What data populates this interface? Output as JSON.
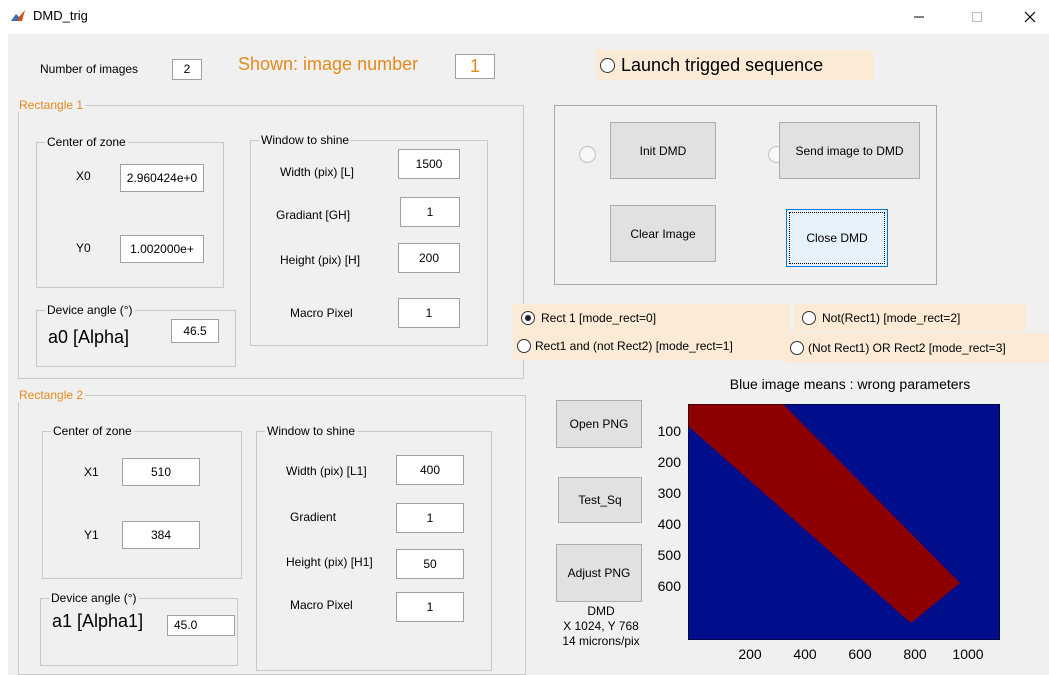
{
  "window": {
    "title": "DMD_trig"
  },
  "header": {
    "num_images_label": "Number of images",
    "num_images_value": "2",
    "shown_label": "Shown: image number",
    "shown_value": "1",
    "launch_label": "Launch trigged sequence"
  },
  "rect1": {
    "title": "Rectangle 1",
    "center_title": "Center of zone",
    "x_label": "X0",
    "x_value": "2.960424e+0",
    "y_label": "Y0",
    "y_value": "1.002000e+",
    "angle_title": "Device angle (°)",
    "angle_label": "a0 [Alpha]",
    "angle_value": "46.5",
    "window_title": "Window to shine",
    "width_label": "Width (pix) [L]",
    "width_value": "1500",
    "grad_label": "Gradiant [GH]",
    "grad_value": "1",
    "height_label": "Height (pix) [H]",
    "height_value": "200",
    "macro_label": "Macro Pixel",
    "macro_value": "1"
  },
  "rect2": {
    "title": "Rectangle 2",
    "center_title": "Center of zone",
    "x_label": "X1",
    "x_value": "510",
    "y_label": "Y1",
    "y_value": "384",
    "angle_title": "Device angle (°)",
    "angle_label": "a1 [Alpha1]",
    "angle_value": "45.0",
    "window_title": "Window to shine",
    "width_label": "Width (pix) [L1]",
    "width_value": "400",
    "grad_label": "Gradient",
    "grad_value": "1",
    "height_label": "Height (pix) [H1]",
    "height_value": "50",
    "macro_label": "Macro Pixel",
    "macro_value": "1"
  },
  "dmd_controls": {
    "init": "Init DMD",
    "send": "Send image to DMD",
    "clear": "Clear Image",
    "close": "Close DMD"
  },
  "modes": {
    "m0": "Rect 1 [mode_rect=0]",
    "m1": "Rect1 and (not Rect2) [mode_rect=1]",
    "m2": "Not(Rect1) [mode_rect=2]",
    "m3": "(Not Rect1) OR Rect2 [mode_rect=3]",
    "selected": "m0"
  },
  "side_buttons": {
    "open_png": "Open PNG",
    "test_sq": "Test_Sq",
    "adjust_png": "Adjust PNG"
  },
  "dmd_info": {
    "line1": "DMD",
    "line2": "X 1024, Y 768",
    "line3": "14 microns/pix"
  },
  "preview": {
    "title": "Blue image means : wrong parameters",
    "y_ticks": [
      "100",
      "200",
      "300",
      "400",
      "500",
      "600"
    ],
    "x_ticks": [
      "200",
      "400",
      "600",
      "800",
      "1000"
    ],
    "background_color": "#000e8c",
    "stripe_color": "#8c0000"
  }
}
